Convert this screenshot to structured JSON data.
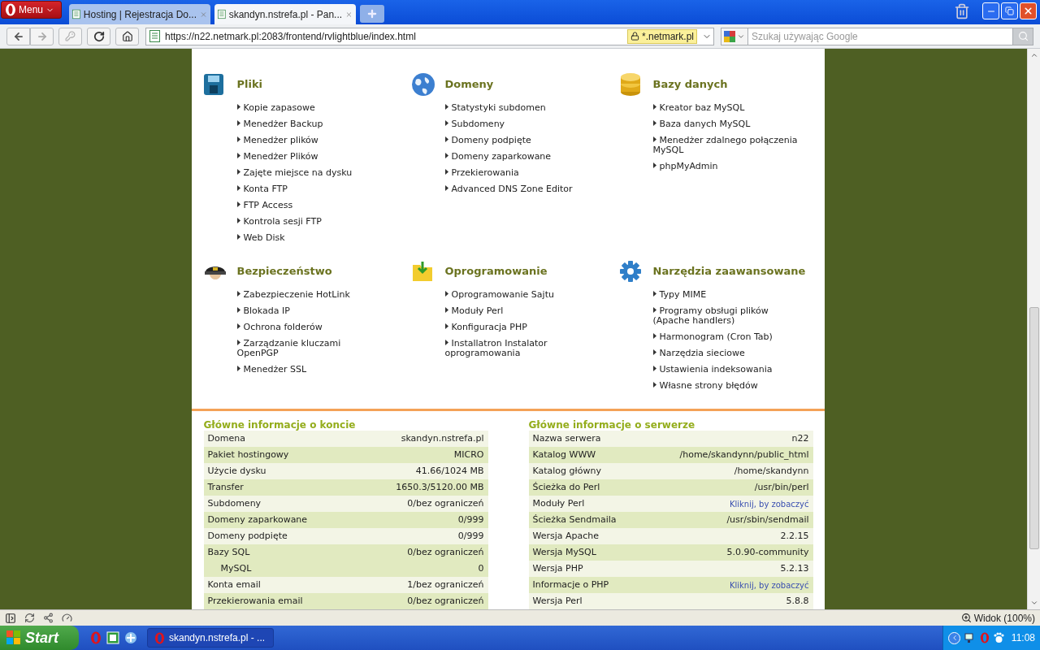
{
  "browser": {
    "menu_button": "Menu",
    "tabs": [
      {
        "title": "Hosting | Rejestracja Do...",
        "selected": false
      },
      {
        "title": "skandyn.nstrefa.pl - Pan...",
        "selected": true
      }
    ],
    "address": "https://n22.netmark.pl:2083/frontend/rvlightblue/index.html",
    "certificate": "*.netmark.pl",
    "search": {
      "placeholder": "Szukaj używając Google"
    }
  },
  "sections": [
    {
      "kind": "files",
      "title": "Pliki",
      "items": [
        "Kopie zapasowe",
        "Menedżer Backup",
        "Menedżer plików",
        "Menedżer Plików",
        "Zajęte miejsce na dysku",
        "Konta FTP",
        "FTP Access",
        "Kontrola sesji FTP",
        "Web Disk"
      ]
    },
    {
      "kind": "domains",
      "title": "Domeny",
      "items": [
        "Statystyki subdomen",
        "Subdomeny",
        "Domeny podpięte",
        "Domeny zaparkowane",
        "Przekierowania",
        "Advanced DNS Zone Editor"
      ]
    },
    {
      "kind": "databases",
      "title": "Bazy danych",
      "items": [
        "Kreator baz MySQL",
        "Baza danych MySQL",
        "Menedżer zdalnego połączenia MySQL",
        "phpMyAdmin"
      ]
    },
    {
      "kind": "security",
      "title": "Bezpieczeństwo",
      "items": [
        "Zabezpieczenie HotLink",
        "Blokada IP",
        "Ochrona folderów",
        "Zarządzanie kluczami OpenPGP",
        "Menedżer SSL"
      ]
    },
    {
      "kind": "software",
      "title": "Oprogramowanie",
      "items": [
        "Oprogramowanie Sajtu",
        "Moduły Perl",
        "Konfiguracja PHP",
        "Installatron Instalator oprogramowania"
      ]
    },
    {
      "kind": "advanced",
      "title": "Narzędzia zaawansowane",
      "items": [
        "Typy MIME",
        "Programy obsługi plików (Apache handlers)",
        "Harmonogram (Cron Tab)",
        "Narzędzia sieciowe",
        "Ustawienia indeksowania",
        "Własne strony błędów"
      ]
    }
  ],
  "account_info": {
    "title": "Główne informacje o koncie",
    "rows": [
      {
        "label": "Domena",
        "value": "skandyn.nstrefa.pl",
        "kind": "text"
      },
      {
        "label": "Pakiet hostingowy",
        "value": "MICRO",
        "kind": "text"
      },
      {
        "label": "Użycie dysku",
        "value": "41.66/1024 MB",
        "kind": "text"
      },
      {
        "label": "Transfer",
        "value": "1650.3/5120.00 MB",
        "kind": "text"
      },
      {
        "label": "Subdomeny",
        "value": "0/bez ograniczeń",
        "kind": "text"
      },
      {
        "label": "Domeny zaparkowane",
        "value": "0/999",
        "kind": "text"
      },
      {
        "label": "Domeny podpięte",
        "value": "0/999",
        "kind": "text"
      },
      {
        "label": "Bazy SQL",
        "value": "0/bez ograniczeń",
        "kind": "text",
        "children": [
          {
            "label": "MySQL",
            "value": "0",
            "kind": "text"
          }
        ]
      },
      {
        "label": "Konta email",
        "value": "1/bez ograniczeń",
        "kind": "text"
      },
      {
        "label": "Przekierowania email",
        "value": "0/bez ograniczeń",
        "kind": "text"
      }
    ]
  },
  "server_info": {
    "title": "Główne informacje o serwerze",
    "rows": [
      {
        "label": "Nazwa serwera",
        "value": "n22",
        "kind": "text"
      },
      {
        "label": "Katalog WWW",
        "value": "/home/skandynn/public_html",
        "kind": "text"
      },
      {
        "label": "Katalog główny",
        "value": "/home/skandynn",
        "kind": "text"
      },
      {
        "label": "Ścieżka do Perl",
        "value": "/usr/bin/perl",
        "kind": "text"
      },
      {
        "label": "Moduły Perl",
        "value": "Kliknij, by zobaczyć",
        "kind": "link"
      },
      {
        "label": "Ścieżka Sendmaila",
        "value": "/usr/sbin/sendmail",
        "kind": "text"
      },
      {
        "label": "Wersja Apache",
        "value": "2.2.15",
        "kind": "text"
      },
      {
        "label": "Wersja MySQL",
        "value": "5.0.90-community",
        "kind": "text"
      },
      {
        "label": "Wersja PHP",
        "value": "5.2.13",
        "kind": "text"
      },
      {
        "label": "Informacje o PHP",
        "value": "Kliknij, by zobaczyć",
        "kind": "link"
      },
      {
        "label": "Wersja Perl",
        "value": "5.8.8",
        "kind": "text"
      }
    ]
  },
  "status_bar": {
    "zoom": "Widok (100%)"
  },
  "taskbar": {
    "start": "Start",
    "tasks": [
      "skandyn.nstrefa.pl - ..."
    ],
    "clock": "11:08"
  }
}
